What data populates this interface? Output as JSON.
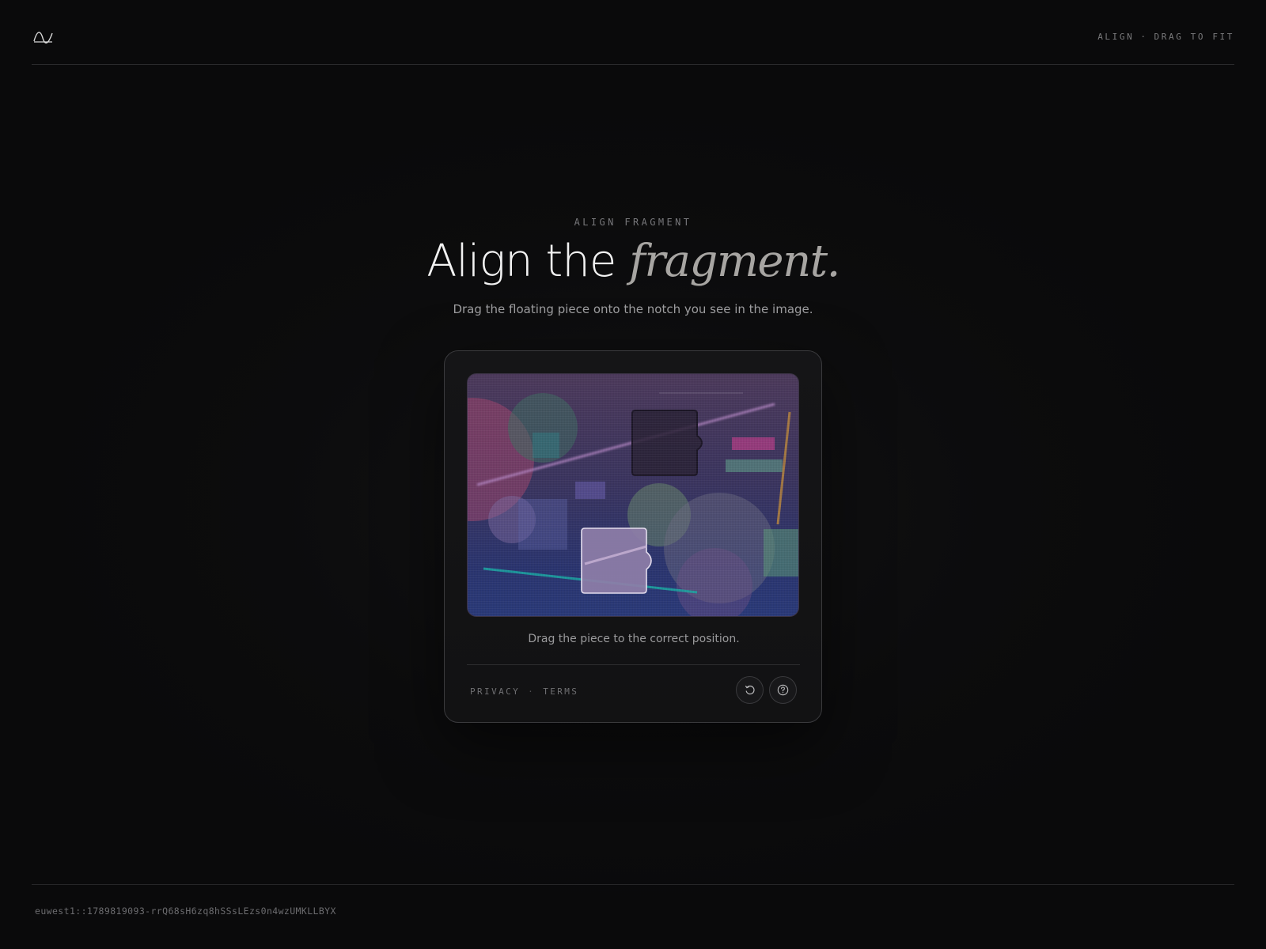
{
  "header": {
    "logo_icon": "wave-logo-icon",
    "nav_primary": "ALIGN",
    "nav_separator": "·",
    "nav_secondary": "DRAG TO FIT"
  },
  "hero": {
    "eyebrow": "ALIGN FRAGMENT",
    "title_plain": "Align the ",
    "title_accent": "fragment.",
    "subtitle": "Drag the floating piece onto the notch you see in the image."
  },
  "captcha": {
    "hint": "Drag the piece to the correct position.",
    "links": {
      "privacy": "PRIVACY",
      "separator": "·",
      "terms": "TERMS"
    },
    "buttons": {
      "reload_icon": "reload-icon",
      "help_icon": "help-icon"
    }
  },
  "footer": {
    "session_id": "euwest1::1789819093-rrQ68sH6zq8hSSsLEzs0n4wzUMKLLBYX"
  }
}
